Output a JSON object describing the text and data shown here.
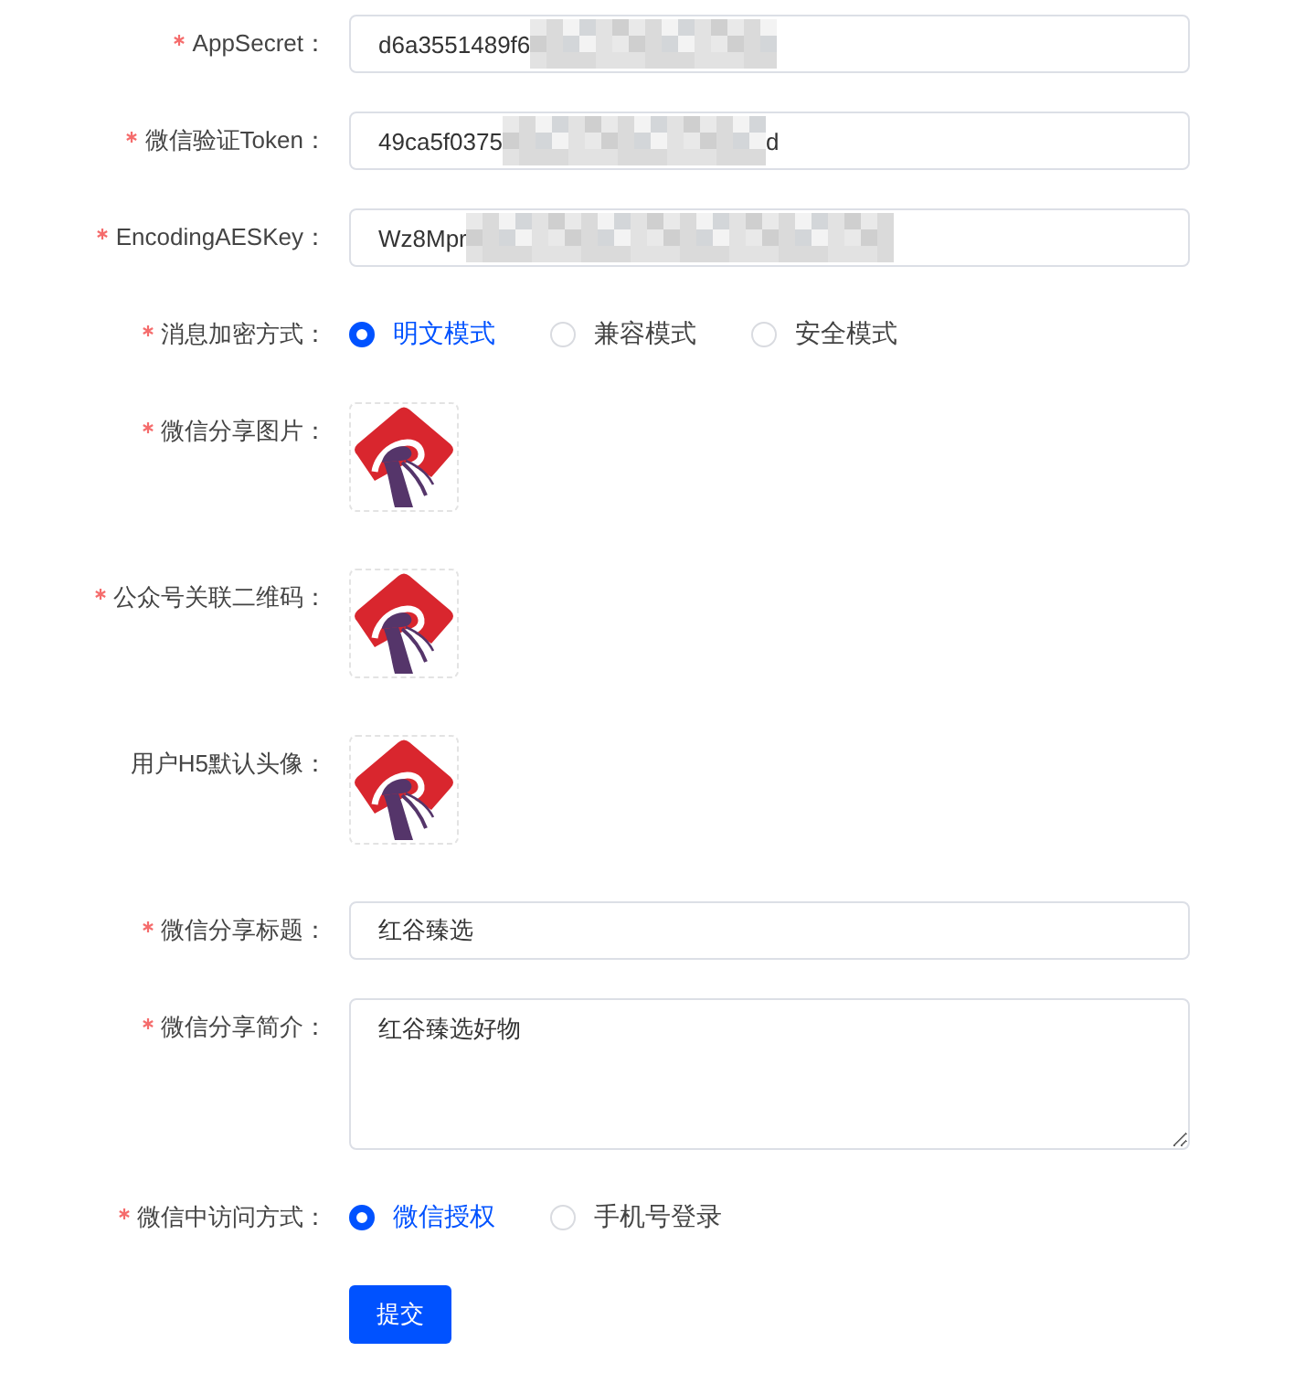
{
  "form": {
    "fields": [
      {
        "kind": "text",
        "label": "AppSecret：",
        "required": true,
        "value": "d6a3551489f6",
        "redacted": true
      },
      {
        "kind": "text",
        "label": "微信验证Token：",
        "required": true,
        "value": "49ca5f0375",
        "redacted": true,
        "value_tail": "d"
      },
      {
        "kind": "text",
        "label": "EncodingAESKey：",
        "required": true,
        "value": "Wz8Mpr",
        "redacted": true
      },
      {
        "kind": "radio",
        "label": "消息加密方式：",
        "required": true,
        "options": [
          {
            "label": "明文模式",
            "selected": true
          },
          {
            "label": "兼容模式",
            "selected": false
          },
          {
            "label": "安全模式",
            "selected": false
          }
        ]
      },
      {
        "kind": "image",
        "label": "微信分享图片：",
        "required": true
      },
      {
        "kind": "image",
        "label": "公众号关联二维码：",
        "required": true
      },
      {
        "kind": "image",
        "label": "用户H5默认头像：",
        "required": false
      },
      {
        "kind": "text",
        "label": "微信分享标题：",
        "required": true,
        "value": "红谷臻选",
        "redacted": false
      },
      {
        "kind": "textarea",
        "label": "微信分享简介：",
        "required": true,
        "value": "红谷臻选好物"
      },
      {
        "kind": "radio",
        "label": "微信中访问方式：",
        "required": true,
        "options": [
          {
            "label": "微信授权",
            "selected": true
          },
          {
            "label": "手机号登录",
            "selected": false
          }
        ]
      }
    ],
    "submit_button": "提交"
  }
}
